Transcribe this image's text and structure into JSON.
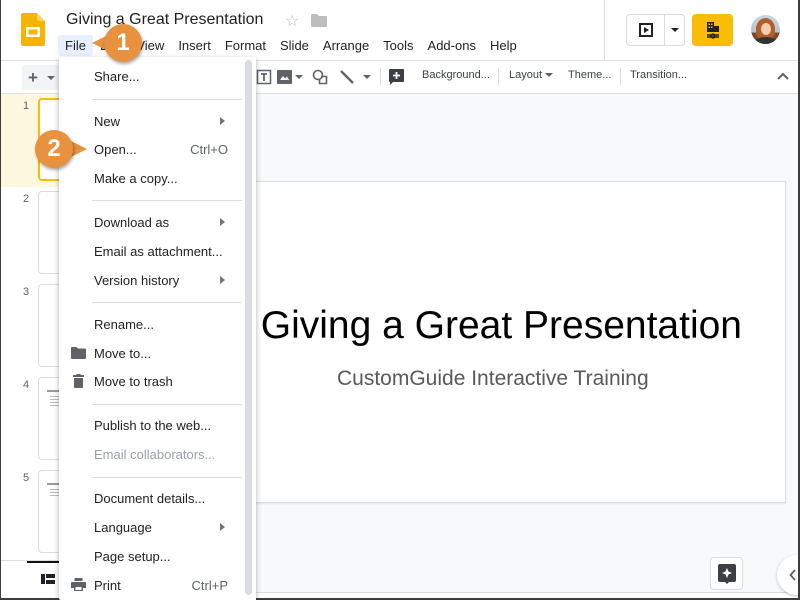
{
  "header": {
    "app": "Google Slides",
    "title": "Giving a Great Presentation",
    "menu": [
      "File",
      "Edit",
      "View",
      "Insert",
      "Format",
      "Slide",
      "Arrange",
      "Tools",
      "Add-ons",
      "Help"
    ],
    "active_menu": "File",
    "accent_color": "#fbbc04"
  },
  "toolbar": {
    "background_label": "Background...",
    "layout_label": "Layout",
    "theme_label": "Theme...",
    "transition_label": "Transition..."
  },
  "filmstrip": {
    "slides": [
      {
        "number": "1",
        "selected": true
      },
      {
        "number": "2",
        "selected": false
      },
      {
        "number": "3",
        "selected": false
      },
      {
        "number": "4",
        "selected": false
      },
      {
        "number": "5",
        "selected": false
      }
    ]
  },
  "slide": {
    "title": "Giving a Great Presentation",
    "subtitle": "CustomGuide Interactive Training"
  },
  "file_menu": {
    "items": [
      {
        "label": "Share..."
      },
      {
        "label": "New",
        "submenu": true
      },
      {
        "label": "Open...",
        "shortcut": "Ctrl+O"
      },
      {
        "label": "Make a copy..."
      },
      {
        "label": "Download as",
        "submenu": true
      },
      {
        "label": "Email as attachment..."
      },
      {
        "label": "Version history",
        "submenu": true
      },
      {
        "label": "Rename..."
      },
      {
        "label": "Move to...",
        "icon": "folder-icon"
      },
      {
        "label": "Move to trash",
        "icon": "trash-icon"
      },
      {
        "label": "Publish to the web..."
      },
      {
        "label": "Email collaborators...",
        "disabled": true
      },
      {
        "label": "Document details..."
      },
      {
        "label": "Language",
        "submenu": true
      },
      {
        "label": "Page setup..."
      },
      {
        "label": "Print",
        "shortcut": "Ctrl+P",
        "icon": "print-icon"
      }
    ]
  },
  "callouts": {
    "step1": "1",
    "step2": "2",
    "color": "#e8913f"
  }
}
